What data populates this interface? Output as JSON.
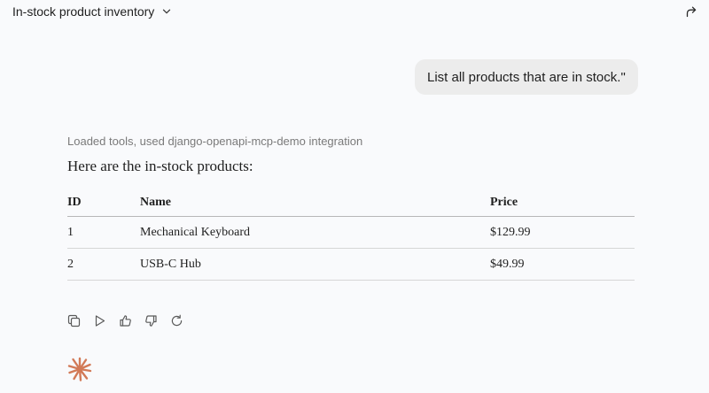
{
  "header": {
    "title": "In-stock product inventory"
  },
  "conversation": {
    "user_message": "List all products that are in stock.\"",
    "tools_status": "Loaded tools, used django-openapi-mcp-demo integration",
    "assistant_intro": "Here are the in-stock products:",
    "table": {
      "headers": [
        "ID",
        "Name",
        "Price"
      ],
      "rows": [
        {
          "id": "1",
          "name": "Mechanical Keyboard",
          "price": "$129.99"
        },
        {
          "id": "2",
          "name": "USB-C Hub",
          "price": "$49.99"
        }
      ]
    }
  },
  "actions": [
    {
      "icon": "copy-icon"
    },
    {
      "icon": "play-icon"
    },
    {
      "icon": "thumbs-up-icon"
    },
    {
      "icon": "thumbs-down-icon"
    },
    {
      "icon": "retry-icon"
    }
  ],
  "colors": {
    "background": "#f9fafc",
    "bubble": "#ececec",
    "muted_text": "#7a7a7a",
    "spark": "#d27a57"
  }
}
